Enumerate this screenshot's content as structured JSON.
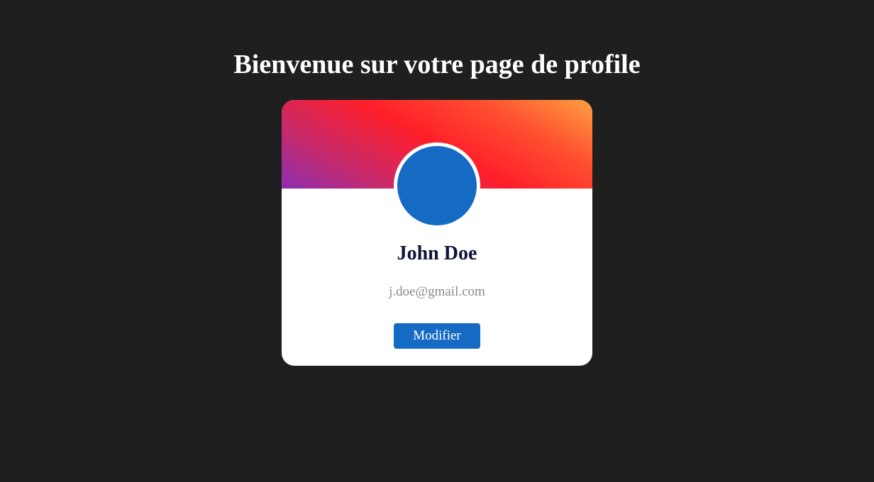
{
  "page": {
    "title": "Bienvenue sur votre page de profile",
    "background_color": "#1f1f1f"
  },
  "profile_card": {
    "banner_gradient": [
      "#8b2fb0",
      "#ff1f2a",
      "#ffa040"
    ],
    "avatar_color": "#156ac4",
    "name": "John Doe",
    "email": "j.doe@gmail.com",
    "edit_button_label": "Modifier",
    "button_color": "#156ac4"
  }
}
